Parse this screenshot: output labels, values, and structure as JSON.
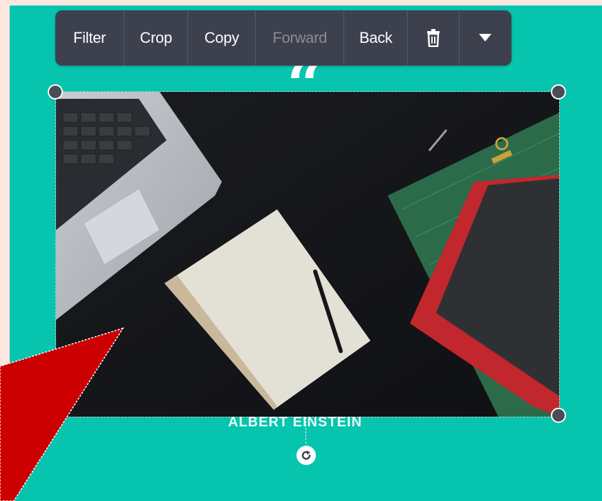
{
  "toolbar": {
    "buttons": [
      {
        "label": "Filter",
        "enabled": true
      },
      {
        "label": "Crop",
        "enabled": true
      },
      {
        "label": "Copy",
        "enabled": true
      },
      {
        "label": "Forward",
        "enabled": false
      },
      {
        "label": "Back",
        "enabled": true
      }
    ],
    "delete_icon": "trash-icon",
    "more_icon": "chevron-down-icon"
  },
  "design": {
    "quote_mark": "“",
    "caption": "ALBERT EINSTEIN"
  },
  "colors": {
    "canvas": "#07c4ae",
    "toolbar": "#3d414e",
    "annotation_arrow": "#cc0000"
  }
}
